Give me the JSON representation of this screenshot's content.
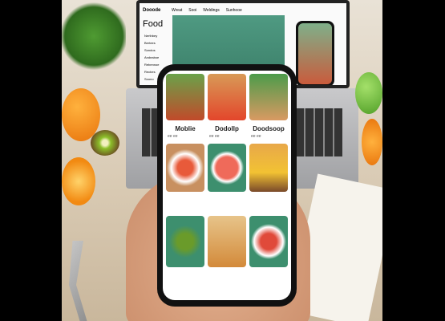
{
  "laptop_screen": {
    "brand": "Dooode",
    "nav": [
      "Wreat",
      "Sooi",
      "Weldings",
      "Sunhooe"
    ],
    "title": "Food",
    "sidebar": [
      "Nerthbey",
      "Bertees",
      "Sondos",
      "Andeaboe",
      "Rebennoe",
      "Recbes",
      "Soono"
    ]
  },
  "phone_screen": {
    "cards": [
      {
        "label": "Moblie",
        "meta": "ee ee"
      },
      {
        "label": "Dodollp",
        "meta": "ee ee"
      },
      {
        "label": "Doodsoop",
        "meta": "ee ee"
      }
    ]
  },
  "colors": {
    "accent": "#3d8f6e",
    "orange": "#f28a12",
    "apple": "#6fbf3a"
  }
}
